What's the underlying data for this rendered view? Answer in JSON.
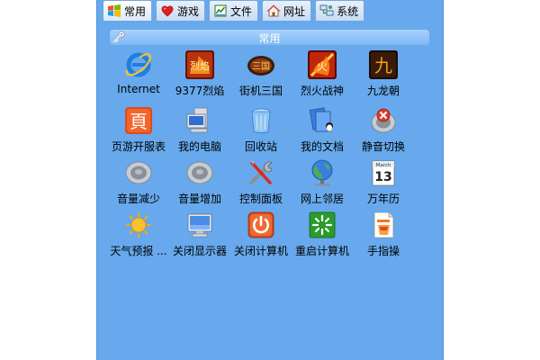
{
  "tabs": [
    {
      "label": "常用",
      "icon": "windows-flag-icon",
      "active": true
    },
    {
      "label": "游戏",
      "icon": "heart-icon",
      "active": false
    },
    {
      "label": "文件",
      "icon": "file-chart-icon",
      "active": false
    },
    {
      "label": "网址",
      "icon": "home-icon",
      "active": false
    },
    {
      "label": "系统",
      "icon": "network-icon",
      "active": false
    }
  ],
  "section": {
    "title": "常用",
    "icon": "key-icon"
  },
  "apps": [
    {
      "label": "Internet",
      "icon": "ie-icon"
    },
    {
      "label": "9377烈焰",
      "icon": "game-lieyan-icon"
    },
    {
      "label": "街机三国",
      "icon": "game-sanguo-icon"
    },
    {
      "label": "烈火战神",
      "icon": "game-liehuo-icon"
    },
    {
      "label": "九龙朝",
      "icon": "game-jiulong-icon"
    },
    {
      "label": "页游开服表",
      "icon": "page-ye-icon"
    },
    {
      "label": "我的电脑",
      "icon": "computer-icon"
    },
    {
      "label": "回收站",
      "icon": "recycle-bin-icon"
    },
    {
      "label": "我的文档",
      "icon": "documents-icon"
    },
    {
      "label": "静音切换",
      "icon": "mute-icon"
    },
    {
      "label": "音量减少",
      "icon": "volume-down-icon"
    },
    {
      "label": "音量增加",
      "icon": "volume-up-icon"
    },
    {
      "label": "控制面板",
      "icon": "control-panel-icon"
    },
    {
      "label": "网上邻居",
      "icon": "network-neighborhood-icon"
    },
    {
      "label": "万年历",
      "icon": "calendar-icon"
    },
    {
      "label": "天气预报 ...",
      "icon": "weather-sun-icon"
    },
    {
      "label": "关闭显示器",
      "icon": "monitor-icon"
    },
    {
      "label": "关闭计算机",
      "icon": "power-icon"
    },
    {
      "label": "重启计算机",
      "icon": "restart-icon"
    },
    {
      "label": "手指操",
      "icon": "finger-exercise-icon"
    }
  ],
  "calendar": {
    "month": "March",
    "day": "13"
  },
  "game_glyphs": {
    "lieyan": "烈焰",
    "sanguo": "三国",
    "liehuo": "火",
    "jiulong": "九",
    "ye": "頁"
  }
}
